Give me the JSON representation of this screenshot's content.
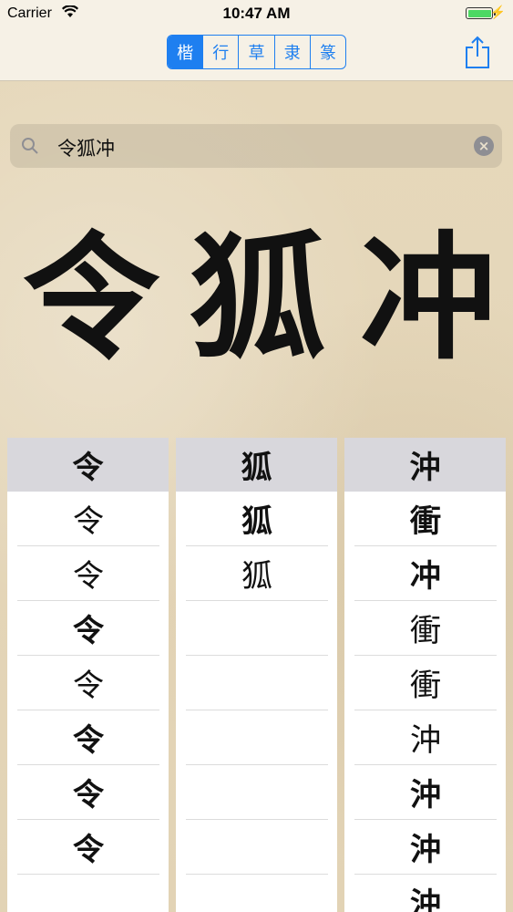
{
  "status_bar": {
    "carrier": "Carrier",
    "time": "10:47 AM"
  },
  "style_tabs": [
    {
      "label": "楷",
      "selected": true
    },
    {
      "label": "行",
      "selected": false
    },
    {
      "label": "草",
      "selected": false
    },
    {
      "label": "隶",
      "selected": false
    },
    {
      "label": "篆",
      "selected": false
    }
  ],
  "search": {
    "query": "令狐冲"
  },
  "big_characters": [
    "令",
    "狐",
    "冲"
  ],
  "columns": [
    {
      "header": "令",
      "variants": [
        "令",
        "令",
        "令",
        "令",
        "令",
        "令",
        "令",
        ""
      ]
    },
    {
      "header": "狐",
      "variants": [
        "狐",
        "狐",
        "",
        "",
        "",
        "",
        "",
        ""
      ]
    },
    {
      "header": "沖",
      "variants": [
        "衝",
        "冲",
        "衝",
        "衝",
        "沖",
        "沖",
        "沖",
        "沖"
      ]
    }
  ],
  "colors": {
    "accent": "#1e7ff0",
    "paper": "#e6d8bb",
    "header_gray": "#d8d7dc"
  }
}
